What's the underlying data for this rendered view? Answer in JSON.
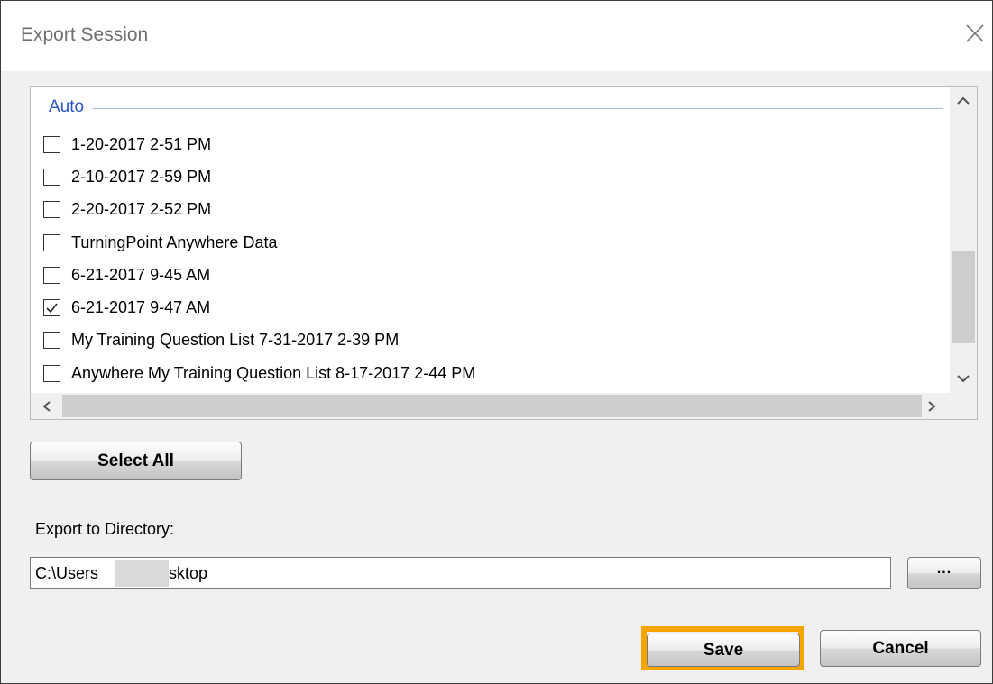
{
  "window": {
    "title": "Export Session",
    "close_icon": "close-icon"
  },
  "session_list": {
    "group_label": "Auto",
    "items": [
      {
        "label": "1-20-2017 2-51 PM",
        "checked": false
      },
      {
        "label": "2-10-2017 2-59 PM",
        "checked": false
      },
      {
        "label": "2-20-2017 2-52 PM",
        "checked": false
      },
      {
        "label": "TurningPoint Anywhere Data",
        "checked": false
      },
      {
        "label": "6-21-2017 9-45 AM",
        "checked": false
      },
      {
        "label": "6-21-2017 9-47 AM",
        "checked": true
      },
      {
        "label": "My Training Question List 7-31-2017 2-39 PM",
        "checked": false
      },
      {
        "label": "Anywhere My Training Question List 8-17-2017 2-44 PM",
        "checked": false
      }
    ]
  },
  "buttons": {
    "select_all": "Select All",
    "browse": "...",
    "save": "Save",
    "cancel": "Cancel"
  },
  "export": {
    "label": "Export to Directory:",
    "directory": "C:\\Users           Desktop"
  },
  "colors": {
    "group_label": "#2a55c4",
    "highlight": "#f5a400"
  }
}
